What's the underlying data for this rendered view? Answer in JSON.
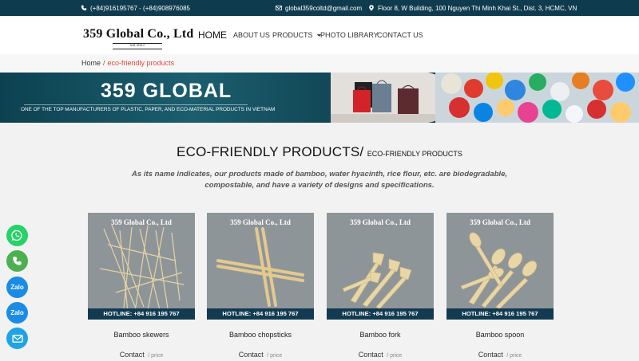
{
  "topbar": {
    "phones": "(+84)916195767 - (+84)908976085",
    "email": "global359coltd@gmail.com",
    "address": "Floor 8, W Building, 100 Nguyen Thi Minh Khai St., Dist. 3, HCMC, VN",
    "icons": [
      "phone-icon",
      "mail-icon",
      "map-pin-icon"
    ]
  },
  "header": {
    "logo_name": "359 Global Co., Ltd",
    "logo_est": "Est 2023",
    "nav": {
      "home": "HOME",
      "about": "ABOUT US",
      "products": "PRODUCTS",
      "photo_library": "PHOTO LIBRARY",
      "contact": "CONTACT US"
    }
  },
  "breadcrumb": {
    "home": "Home",
    "separator": "/",
    "current": "eco-friendly products"
  },
  "banner": {
    "title": "359 GLOBAL",
    "tagline": "ONE OF THE TOP MANUFACTURERS OF PLASTIC, PAPER, AND ECO-MATERIAL PRODUCTS IN VIETNAM"
  },
  "content": {
    "title_main": "ECO-FRIENDLY PRODUCTS/",
    "title_sub": "ECO-FRIENDLY PRODUCTS",
    "description": "As its name indicates, our products made of bamboo, water hyacinth, rice flour, etc. are biodegradable, compostable, and have a variety of designs and specifications."
  },
  "products": [
    {
      "name": "Bamboo skewers",
      "watermark": "359 Global Co., Ltd",
      "hotline": "HOTLINE: +84 916 195 767",
      "contact": "Contact",
      "price_label": "/ price"
    },
    {
      "name": "Bamboo chopsticks",
      "watermark": "359 Global Co., Ltd",
      "hotline": "HOTLINE: +84 916 195 767",
      "contact": "Contact",
      "price_label": "/ price"
    },
    {
      "name": "Bamboo fork",
      "watermark": "359 Global Co., Ltd",
      "hotline": "HOTLINE: +84 916 195 767",
      "contact": "Contact",
      "price_label": "/ price"
    },
    {
      "name": "Bamboo spoon",
      "watermark": "359 Global Co., Ltd",
      "hotline": "HOTLINE: +84 916 195 767",
      "contact": "Contact",
      "price_label": "/ price"
    }
  ],
  "floating": {
    "zalo1": "Zalo",
    "zalo2": "Zalo",
    "icons": [
      "whatsapp-icon",
      "phone-call-icon",
      "zalo-icon",
      "zalo-icon",
      "mail-icon"
    ]
  },
  "colors": {
    "topbar": "#0f3b4f",
    "accent_red": "#e04a3a",
    "whatsapp": "#25d366",
    "phone": "#4caf50",
    "zalo": "#1a8ce5",
    "mail": "#1ea3e8",
    "hotline_bar": "#123b52"
  }
}
